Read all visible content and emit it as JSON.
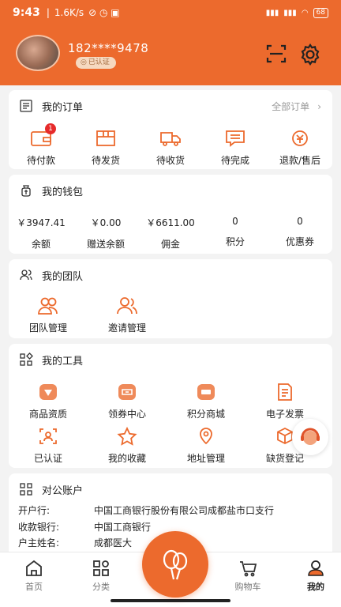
{
  "status_bar": {
    "time": "9:43",
    "network_speed": "1.6K/s",
    "battery": "68"
  },
  "profile": {
    "phone": "182****9478",
    "verified": "已认证"
  },
  "orders": {
    "title": "我的订单",
    "all_link": "全部订单",
    "items": [
      {
        "label": "待付款",
        "icon": "wallet-icon",
        "count": "1"
      },
      {
        "label": "待发货",
        "icon": "package-icon"
      },
      {
        "label": "待收货",
        "icon": "truck-icon"
      },
      {
        "label": "待完成",
        "icon": "message-icon"
      },
      {
        "label": "退款/售后",
        "icon": "refund-icon"
      }
    ]
  },
  "wallet": {
    "title": "我的钱包",
    "items": [
      {
        "value": "￥3947.41",
        "label": "余额"
      },
      {
        "value": "￥0.00",
        "label": "赠送余额"
      },
      {
        "value": "￥6611.00",
        "label": "佣金"
      },
      {
        "value": "0",
        "label": "积分"
      },
      {
        "value": "0",
        "label": "优惠券"
      }
    ]
  },
  "team": {
    "title": "我的团队",
    "items": [
      {
        "label": "团队管理",
        "icon": "team-icon"
      },
      {
        "label": "邀请管理",
        "icon": "invite-icon"
      }
    ]
  },
  "tools": {
    "title": "我的工具",
    "items": [
      {
        "label": "商品资质",
        "icon": "qualification-icon"
      },
      {
        "label": "领券中心",
        "icon": "coupon-icon"
      },
      {
        "label": "积分商城",
        "icon": "points-mall-icon"
      },
      {
        "label": "电子发票",
        "icon": "invoice-icon"
      },
      {
        "label": "已认证",
        "icon": "verified-icon"
      },
      {
        "label": "我的收藏",
        "icon": "star-icon"
      },
      {
        "label": "地址管理",
        "icon": "location-icon"
      },
      {
        "label": "缺货登记",
        "icon": "box-icon"
      }
    ]
  },
  "account": {
    "title": "对公账户",
    "rows": [
      {
        "key": "开户行:",
        "value": "中国工商银行股份有限公司成都盐市口支行"
      },
      {
        "key": "收款银行:",
        "value": "中国工商银行"
      },
      {
        "key": "户主姓名:",
        "value": "成都医大"
      }
    ]
  },
  "tabbar": {
    "items": [
      {
        "label": "首页"
      },
      {
        "label": "分类"
      },
      {
        "label": "购物车"
      },
      {
        "label": "我的"
      }
    ]
  },
  "colors": {
    "brand": "#ec6a2d",
    "badge": "#e62b2b"
  }
}
